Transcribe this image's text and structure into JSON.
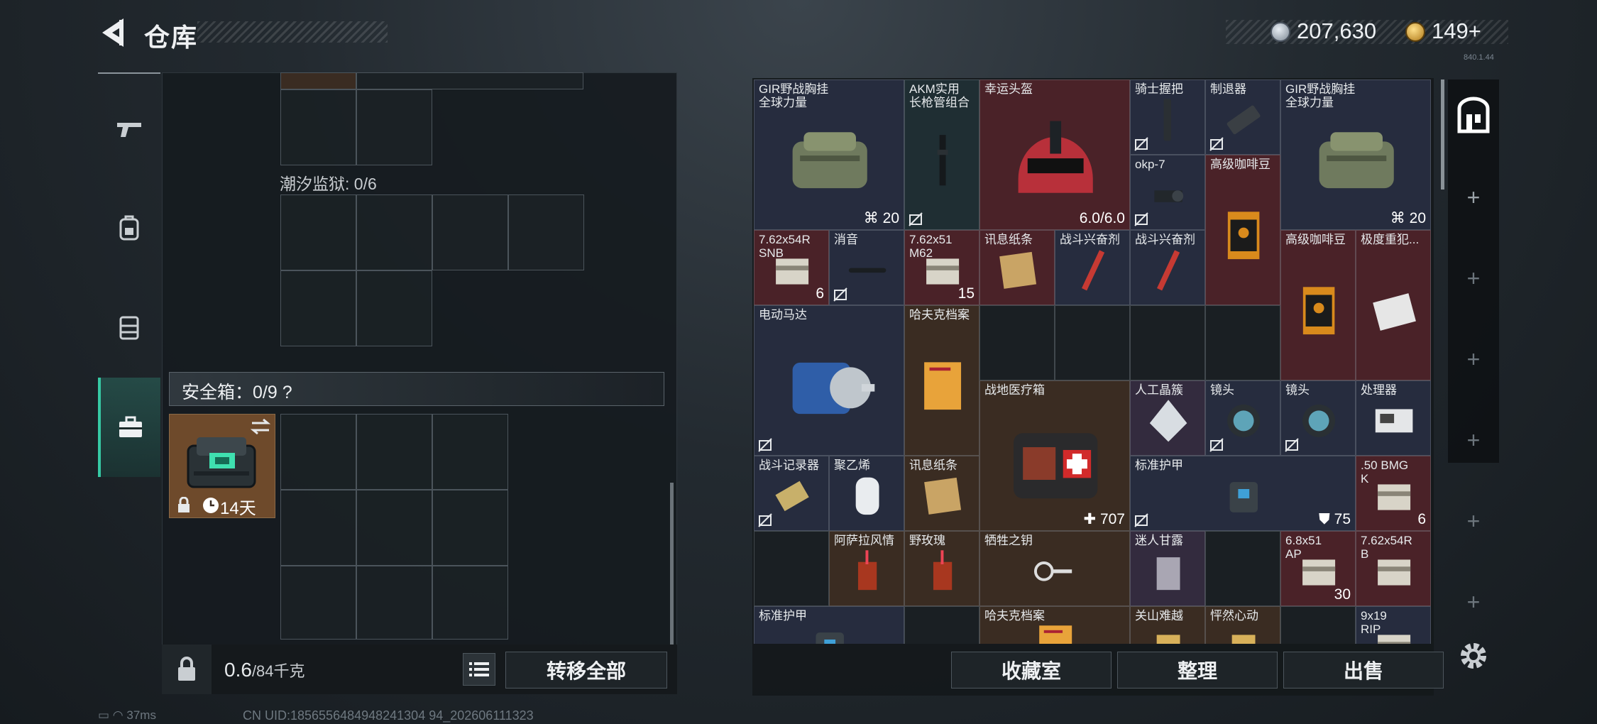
{
  "header": {
    "title": "仓库",
    "currency_silver": "207,630",
    "currency_gold": "149+",
    "version": "840.1.44"
  },
  "left_tabs": [
    "weapon-tab-icon",
    "backpack-tab-icon",
    "chest-rig-tab-icon",
    "safe-box-tab-icon"
  ],
  "left_panel": {
    "tidal_prison_label": "潮汐监狱: 0/6",
    "safe_box_label": "安全箱：0/9",
    "safe_box_help": "?",
    "safe_case_days": "14天",
    "weight_value": "0.6",
    "weight_unit": "/84千克",
    "transfer_all_label": "转移全部"
  },
  "items": [
    {
      "name": "GIR野战胸挂\n全球力量",
      "qty": "20",
      "qty_icon": "durability-icon"
    },
    {
      "name": "AKM实用\n长枪管组合",
      "qty": ""
    },
    {
      "name": "幸运头盔",
      "qty": "6.0/6.0"
    },
    {
      "name": "骑士握把",
      "qty": ""
    },
    {
      "name": "制退器",
      "qty": ""
    },
    {
      "name": "GIR野战胸挂\n全球力量",
      "qty": "20",
      "qty_icon": "durability-icon"
    },
    {
      "name": "okp-7",
      "qty": ""
    },
    {
      "name": "高级咖啡豆",
      "qty": ""
    },
    {
      "name": "7.62x54R\nSNB",
      "qty": "6"
    },
    {
      "name": "消音",
      "qty": ""
    },
    {
      "name": "7.62x51\nM62",
      "qty": "15"
    },
    {
      "name": "讯息纸条",
      "qty": ""
    },
    {
      "name": "战斗兴奋剂",
      "qty": ""
    },
    {
      "name": "战斗兴奋剂",
      "qty": ""
    },
    {
      "name": "高级咖啡豆",
      "qty": ""
    },
    {
      "name": "极度重犯...",
      "qty": ""
    },
    {
      "name": "电动马达",
      "qty": ""
    },
    {
      "name": "哈夫克档案",
      "qty": ""
    },
    {
      "name": "战地医疗箱",
      "qty": "707",
      "qty_icon": "heal-plus-icon"
    },
    {
      "name": "人工晶簇",
      "qty": ""
    },
    {
      "name": "镜头",
      "qty": ""
    },
    {
      "name": "镜头",
      "qty": ""
    },
    {
      "name": "处理器",
      "qty": ""
    },
    {
      "name": "战斗记录器",
      "qty": ""
    },
    {
      "name": "聚乙烯",
      "qty": ""
    },
    {
      "name": "讯息纸条",
      "qty": ""
    },
    {
      "name": "标准护甲",
      "qty": "75",
      "qty_icon": "shield-icon"
    },
    {
      "name": ".50 BMG\nK",
      "qty": "6"
    },
    {
      "name": "阿萨拉风情",
      "qty": ""
    },
    {
      "name": "野玫瑰",
      "qty": ""
    },
    {
      "name": "牺牲之钥",
      "qty": ""
    },
    {
      "name": "迷人甘露",
      "qty": ""
    },
    {
      "name": "6.8x51\nAP",
      "qty": "30"
    },
    {
      "name": "7.62x54R\nB",
      "qty": ""
    },
    {
      "name": "标准护甲",
      "qty": ""
    },
    {
      "name": "哈夫克档案",
      "qty": ""
    },
    {
      "name": "关山难越",
      "qty": ""
    },
    {
      "name": "怦然心动",
      "qty": ""
    },
    {
      "name": "9x19\nRIP",
      "qty": ""
    }
  ],
  "bottom_buttons": {
    "collection": "收藏室",
    "organize": "整理",
    "sell": "出售"
  },
  "status": {
    "ping": "37ms",
    "uid": "CN UID:1856556484948241304 94_202606111323"
  },
  "colors": {
    "accent": "#36c9a4",
    "rarity_red": "#4a2228",
    "rarity_purple": "#332b3e",
    "rarity_blue": "#262c3e",
    "rarity_gold": "#3a2c22"
  }
}
